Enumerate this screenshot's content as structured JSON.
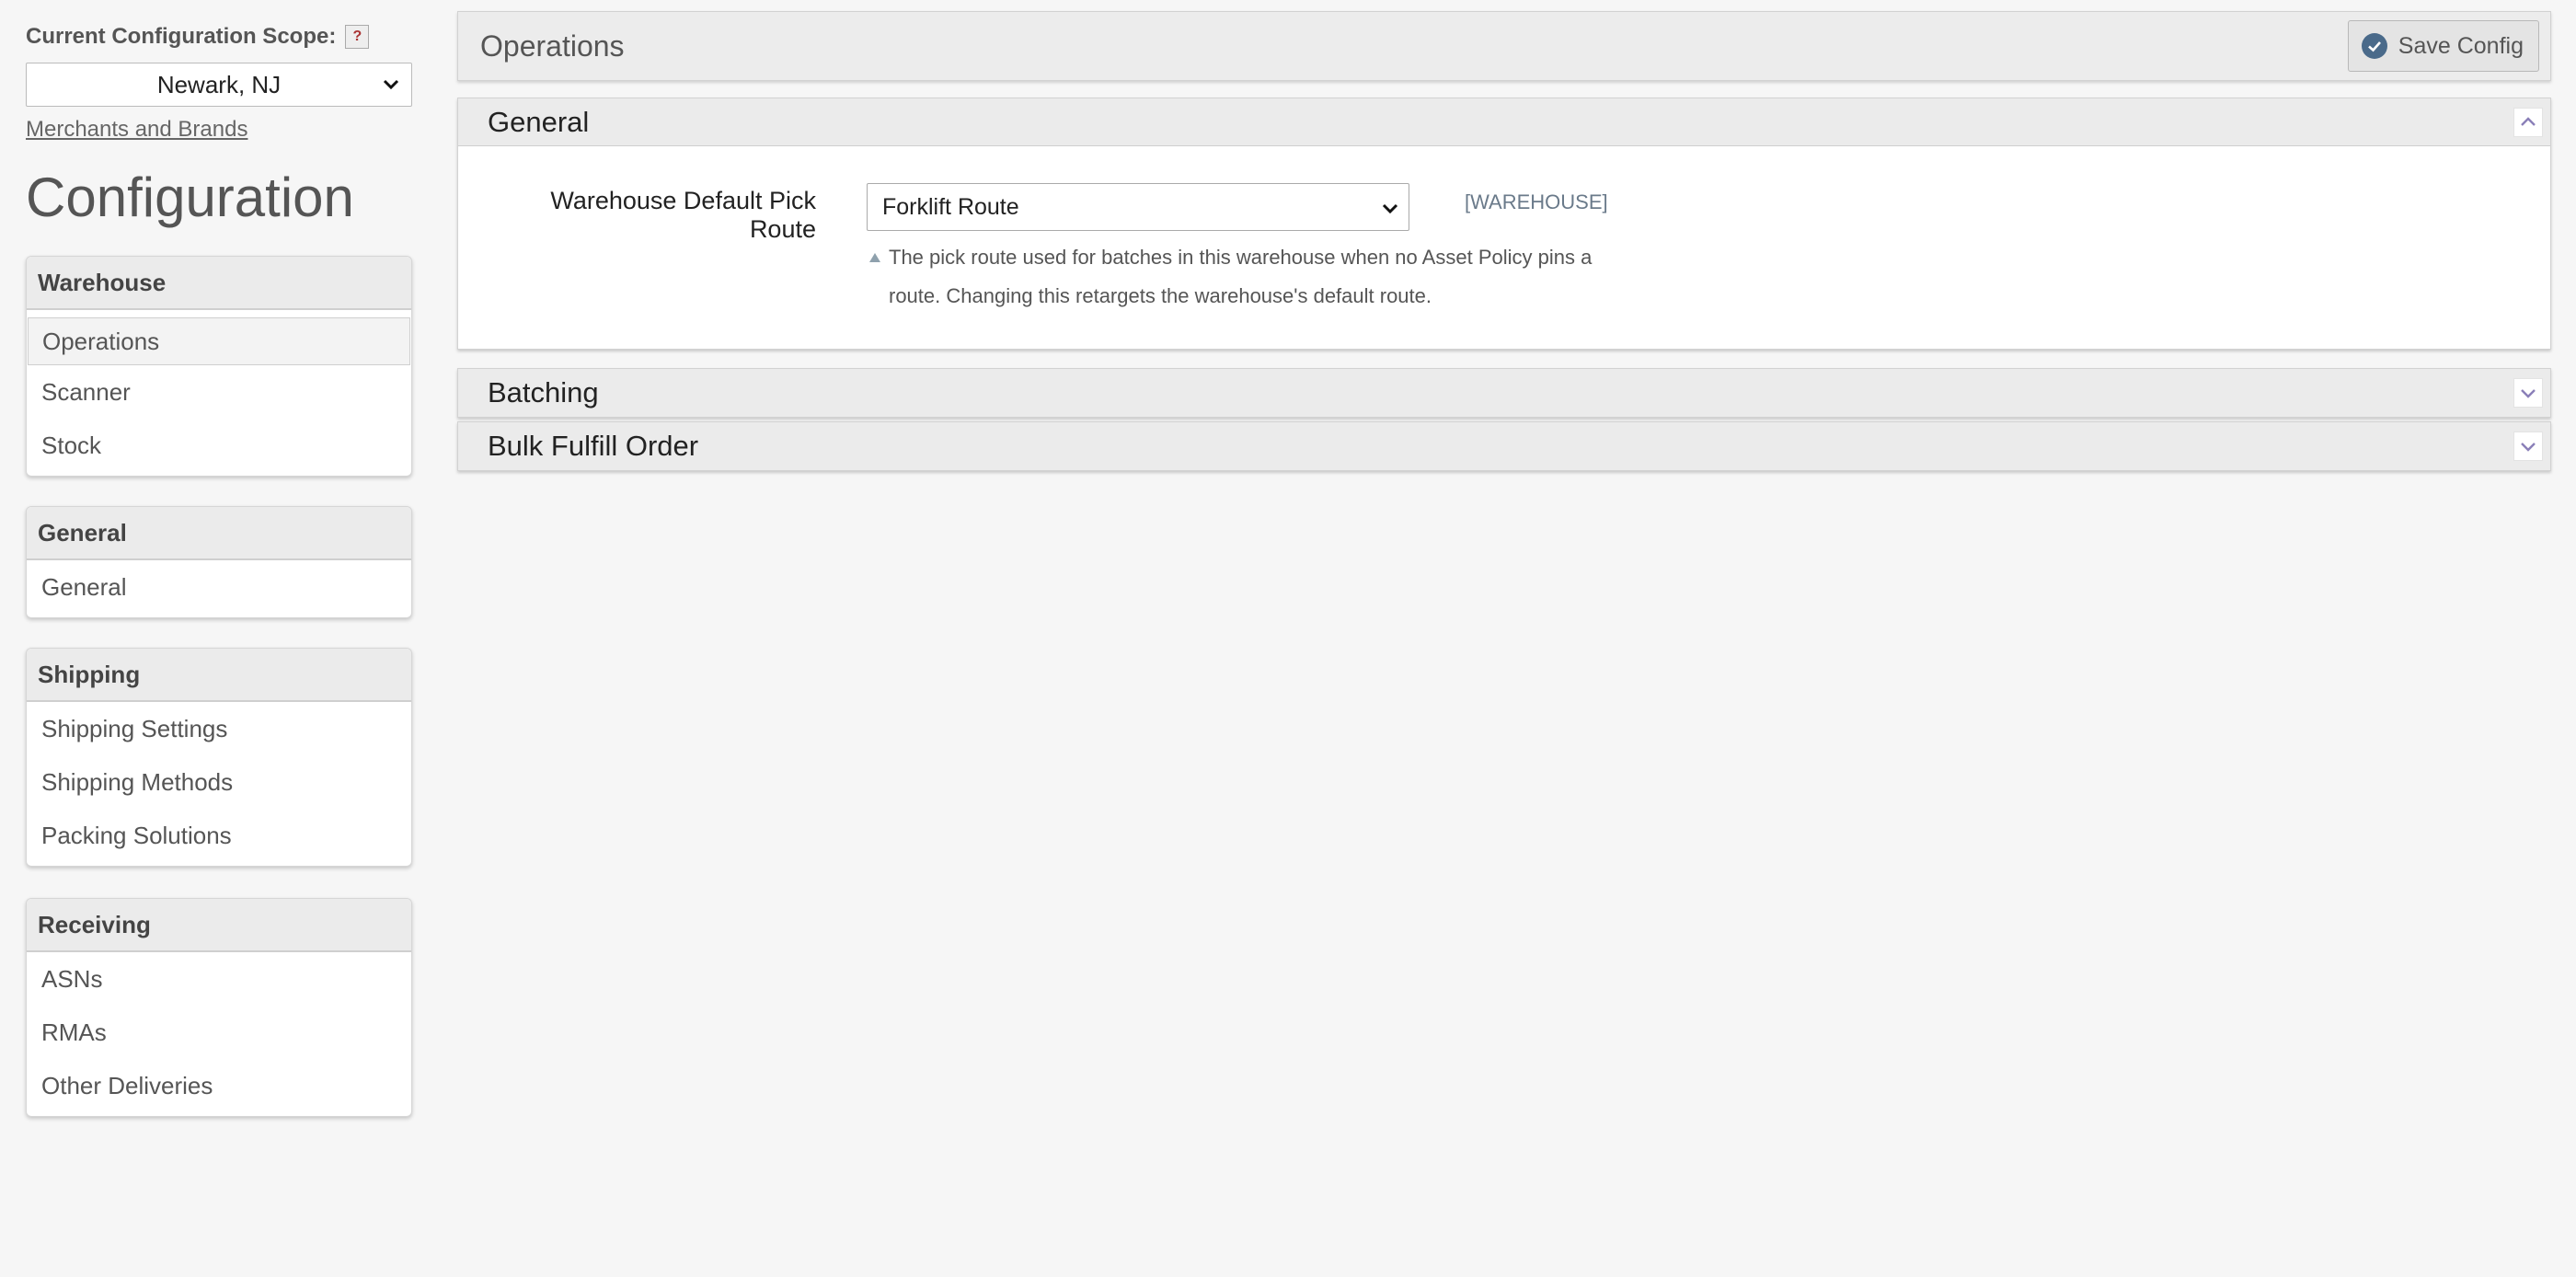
{
  "sidebar": {
    "scope_label": "Current Configuration Scope:",
    "help_badge": "?",
    "scope_value": "Newark, NJ",
    "merchants_link": "Merchants and Brands",
    "title": "Configuration",
    "groups": [
      {
        "header": "Warehouse",
        "items": [
          {
            "label": "Operations",
            "active": true
          },
          {
            "label": "Scanner"
          },
          {
            "label": "Stock"
          }
        ]
      },
      {
        "header": "General",
        "items": [
          {
            "label": "General"
          }
        ]
      },
      {
        "header": "Shipping",
        "items": [
          {
            "label": "Shipping Settings"
          },
          {
            "label": "Shipping Methods"
          },
          {
            "label": "Packing Solutions"
          }
        ]
      },
      {
        "header": "Receiving",
        "items": [
          {
            "label": "ASNs"
          },
          {
            "label": "RMAs"
          },
          {
            "label": "Other Deliveries"
          }
        ]
      }
    ]
  },
  "main": {
    "page_title": "Operations",
    "save_label": "Save Config",
    "sections": [
      {
        "title": "General",
        "state": "expanded",
        "field": {
          "label": "Warehouse Default Pick Route",
          "value": "Forklift Route",
          "scope": "[WAREHOUSE]",
          "comment": "The pick route used for batches in this warehouse when no Asset Policy pins a route. Changing this retargets the warehouse's default route."
        }
      },
      {
        "title": "Batching",
        "state": "collapsed"
      },
      {
        "title": "Bulk Fulfill Order",
        "state": "collapsed"
      }
    ]
  },
  "colors": {
    "background": "#f6f6f6",
    "header_bg": "#ebebeb",
    "save_icon": "#4a6a8a",
    "scope_tag": "#6a7a8a",
    "toggle_chevron": "#8a7fb8"
  }
}
